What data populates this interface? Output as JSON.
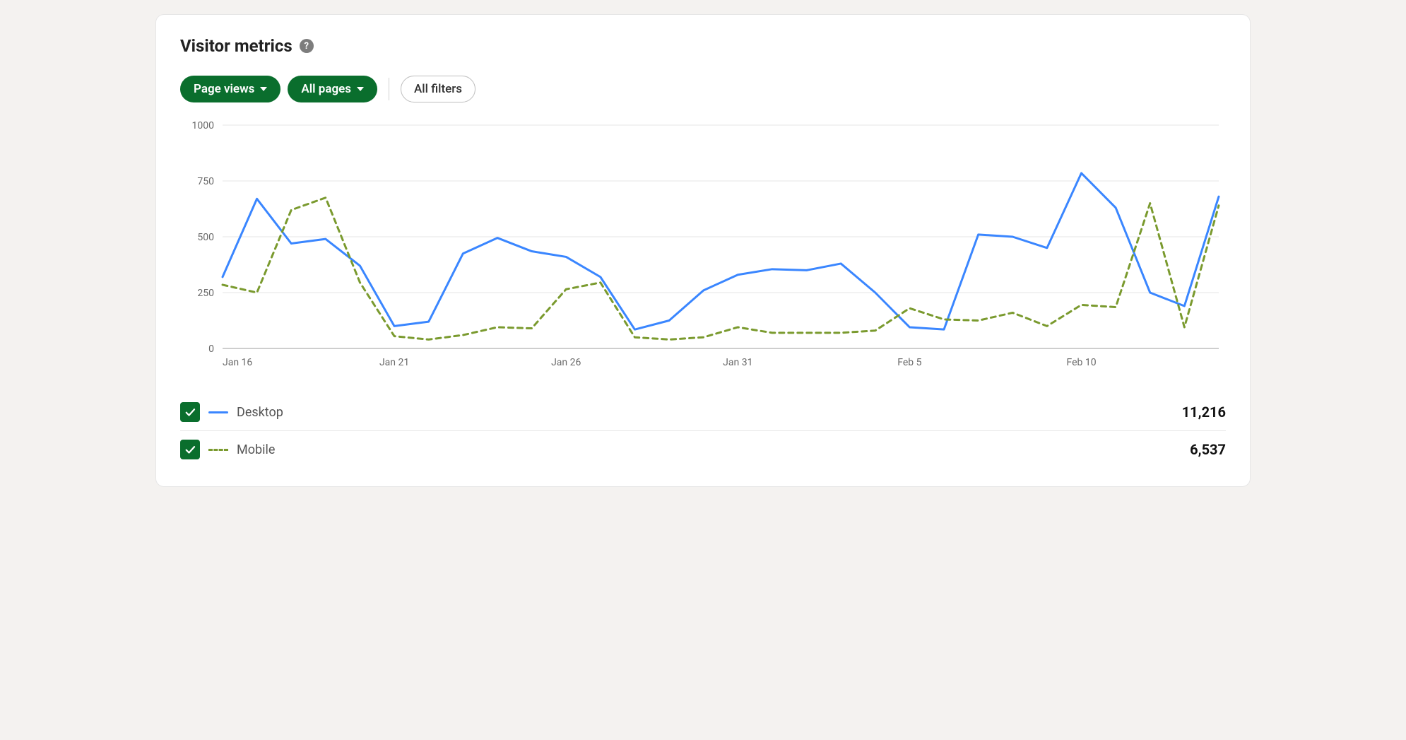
{
  "card_title": "Visitor metrics",
  "filters": {
    "metric_label": "Page views",
    "pages_label": "All pages",
    "all_filters_label": "All filters"
  },
  "legend": {
    "desktop": {
      "label": "Desktop",
      "total": "11,216"
    },
    "mobile": {
      "label": "Mobile",
      "total": "6,537"
    }
  },
  "chart_data": {
    "type": "line",
    "title": "Visitor metrics",
    "xlabel": "",
    "ylabel": "",
    "ylim": [
      0,
      1000
    ],
    "yticks": [
      0,
      250,
      500,
      750,
      1000
    ],
    "x_tick_labels": [
      "Jan 16",
      "Jan 21",
      "Jan 26",
      "Jan 31",
      "Feb 5",
      "Feb 10"
    ],
    "x": [
      "Jan 16",
      "Jan 17",
      "Jan 18",
      "Jan 19",
      "Jan 20",
      "Jan 21",
      "Jan 22",
      "Jan 23",
      "Jan 24",
      "Jan 25",
      "Jan 26",
      "Jan 27",
      "Jan 28",
      "Jan 29",
      "Jan 30",
      "Jan 31",
      "Feb 1",
      "Feb 2",
      "Feb 3",
      "Feb 4",
      "Feb 5",
      "Feb 6",
      "Feb 7",
      "Feb 8",
      "Feb 9",
      "Feb 10",
      "Feb 11",
      "Feb 12",
      "Feb 13",
      "Feb 14"
    ],
    "series": [
      {
        "name": "Desktop",
        "style": "solid",
        "color": "#3a86ff",
        "values": [
          320,
          670,
          470,
          490,
          370,
          100,
          120,
          425,
          495,
          435,
          410,
          320,
          85,
          125,
          260,
          330,
          355,
          350,
          380,
          250,
          95,
          85,
          510,
          500,
          450,
          785,
          630,
          250,
          190,
          680
        ]
      },
      {
        "name": "Mobile",
        "style": "dashed",
        "color": "#7a9a2e",
        "values": [
          285,
          250,
          620,
          675,
          295,
          55,
          40,
          60,
          95,
          90,
          265,
          295,
          50,
          40,
          50,
          95,
          70,
          70,
          70,
          80,
          180,
          130,
          125,
          160,
          100,
          195,
          185,
          650,
          95,
          640
        ]
      }
    ]
  }
}
